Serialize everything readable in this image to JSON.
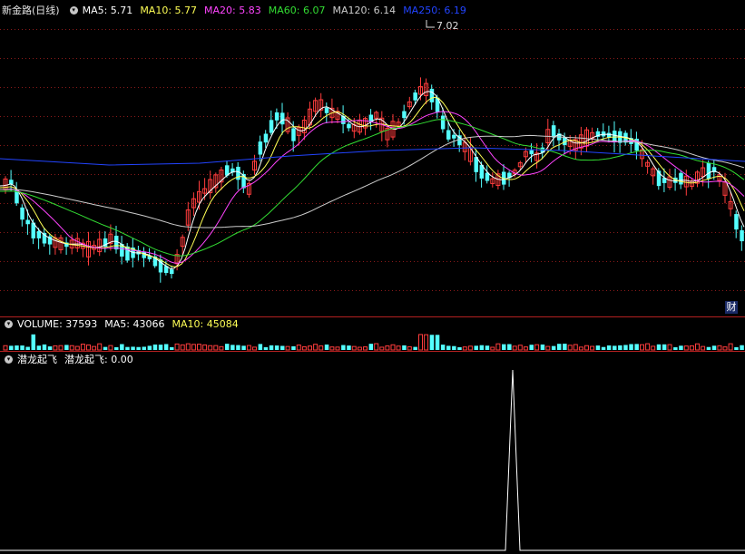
{
  "colors": {
    "up": "#ff3d3d",
    "down": "#54ffff",
    "ma5": "#ffffff",
    "ma10": "#ffff55",
    "ma20": "#ff44ff",
    "ma60": "#33dd33",
    "ma120": "#cccccc",
    "ma250": "#2244ff",
    "grid": "#8a1a1a",
    "panel_border": "#b32020",
    "signal": "#ffffff"
  },
  "price_header": {
    "stock_name": "新金路(日线)",
    "ma5_label": "MA5: 5.71",
    "ma10_label": "MA10: 5.77",
    "ma20_label": "MA20: 5.83",
    "ma60_label": "MA60: 6.07",
    "ma120_label": "MA120: 6.14",
    "ma250_label": "MA250: 6.19",
    "toggle_icon": "chevron-down-icon"
  },
  "max_marker": "7.02",
  "cai_badge": "财",
  "volume_header": {
    "volume_label": "VOLUME: 37593",
    "ma5_label": "MA5: 43066",
    "ma10_label": "MA10: 45084"
  },
  "indicator_header": {
    "name": "潜龙起飞",
    "value_label": "潜龙起飞: 0.00"
  }
}
